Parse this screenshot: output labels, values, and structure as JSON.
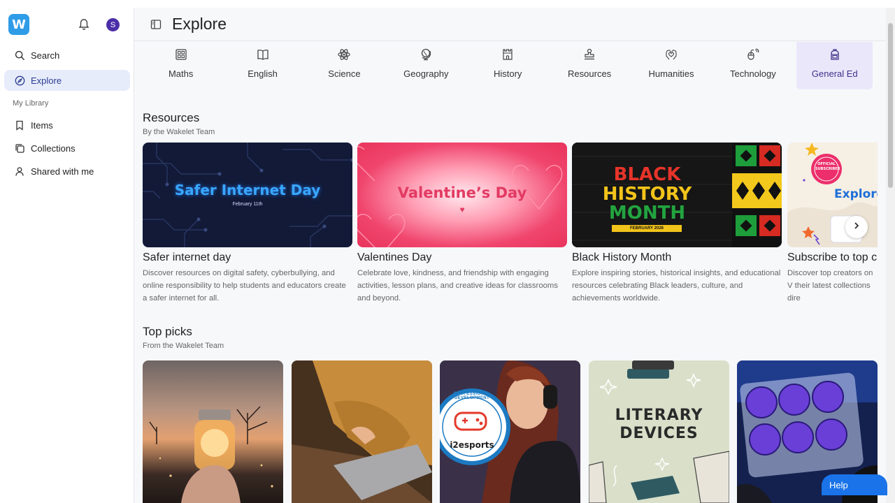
{
  "sidebar": {
    "logo": "W",
    "avatar_initial": "S",
    "search_label": "Search",
    "explore_label": "Explore",
    "library_label": "My Library",
    "items_label": "Items",
    "collections_label": "Collections",
    "shared_label": "Shared with me"
  },
  "header": {
    "title": "Explore"
  },
  "subjects": [
    {
      "label": "Maths",
      "icon": "calculator-icon"
    },
    {
      "label": "English",
      "icon": "book-icon"
    },
    {
      "label": "Science",
      "icon": "atom-icon"
    },
    {
      "label": "Geography",
      "icon": "globe-icon"
    },
    {
      "label": "History",
      "icon": "castle-icon"
    },
    {
      "label": "Resources",
      "icon": "stamp-icon"
    },
    {
      "label": "Humanities",
      "icon": "hands-heart-icon"
    },
    {
      "label": "Technology",
      "icon": "technology-icon"
    },
    {
      "label": "General Ed",
      "icon": "backpack-icon"
    }
  ],
  "resources": {
    "title": "Resources",
    "subtitle": "By the Wakelet Team",
    "cards": [
      {
        "title": "Safer internet day",
        "desc": "Discover resources on digital safety, cyberbullying, and online responsibility to help students and educators create a safer internet for all.",
        "thumb_main": "Safer Internet Day",
        "thumb_sub": "February 11th"
      },
      {
        "title": "Valentines Day",
        "desc": "Celebrate love, kindness, and friendship with engaging activities, lesson plans, and creative ideas for classrooms and beyond.",
        "thumb_main": "Valentine’s Day"
      },
      {
        "title": "Black History Month",
        "desc": "Explore inspiring stories, historical insights, and educational resources celebrating Black leaders, culture, and achievements worldwide.",
        "thumb_line1": "BLACK",
        "thumb_line2": "HISTORY",
        "thumb_line3": "MONTH",
        "thumb_sub": "FEBRUARY 2026"
      },
      {
        "title": "Subscribe to top c",
        "desc": "Discover top creators on V their latest collections dire",
        "thumb_main": "Explore",
        "badge": "OFFICIAL SUBSCRIBER"
      }
    ]
  },
  "top_picks": {
    "title": "Top picks",
    "subtitle": "From the Wakelet Team",
    "cards": [
      {
        "name": "jar-of-lights"
      },
      {
        "name": "laptop-sweater"
      },
      {
        "name": "esports-gamer",
        "badge_text": "i2esports",
        "ring_text": "PROFESSIONAL DEVELOPMENT"
      },
      {
        "name": "literary-devices",
        "line1": "LITERARY",
        "line2": "DEVICES"
      },
      {
        "name": "lab-petri-dishes"
      }
    ]
  },
  "help_label": "Help",
  "colors": {
    "brand": "#2f9ce8",
    "active_bg": "#e7ecfb",
    "subject_active_bg": "#ebe7fb",
    "help_bg": "#1a73e8"
  }
}
